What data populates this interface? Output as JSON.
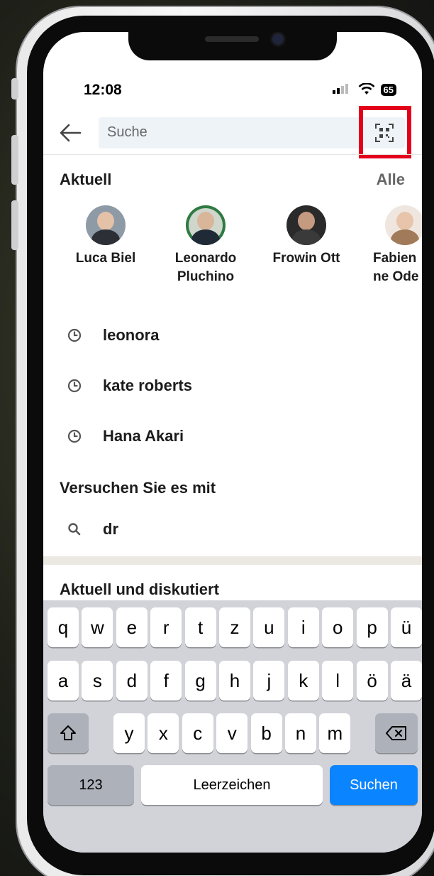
{
  "status": {
    "time": "12:08",
    "battery": "65"
  },
  "search": {
    "placeholder": "Suche"
  },
  "recent": {
    "title": "Aktuell",
    "all_label": "Alle",
    "people": [
      {
        "name": "Luca Biel"
      },
      {
        "name": "Leonardo Pluchino"
      },
      {
        "name": "Frowin Ott"
      },
      {
        "name": "Fabienne Odermatt"
      }
    ]
  },
  "history": [
    {
      "text": "leonora"
    },
    {
      "text": "kate roberts"
    },
    {
      "text": "Hana Akari"
    }
  ],
  "suggestions": {
    "title": "Versuchen Sie es mit",
    "items": [
      {
        "text": "dr"
      }
    ]
  },
  "trending": {
    "title": "Aktuell und diskutiert"
  },
  "keyboard": {
    "row1": [
      "q",
      "w",
      "e",
      "r",
      "t",
      "z",
      "u",
      "i",
      "o",
      "p",
      "ü"
    ],
    "row2": [
      "a",
      "s",
      "d",
      "f",
      "g",
      "h",
      "j",
      "k",
      "l",
      "ö",
      "ä"
    ],
    "row3": [
      "y",
      "x",
      "c",
      "v",
      "b",
      "n",
      "m"
    ],
    "numbers_label": "123",
    "space_label": "Leerzeichen",
    "search_label": "Suchen"
  },
  "colors": {
    "highlight": "#e3001b",
    "keyboard_action": "#0a84ff"
  }
}
